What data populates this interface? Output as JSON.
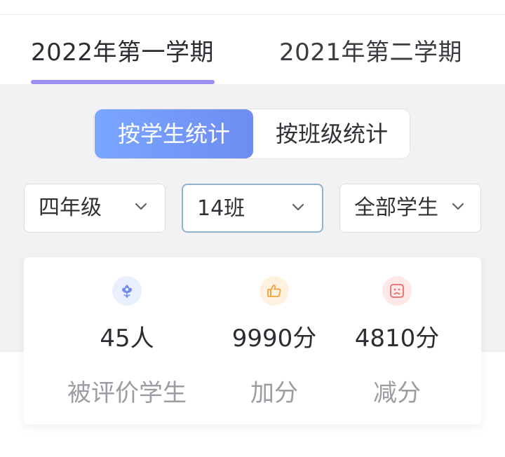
{
  "tabs": [
    {
      "label": "2022年第一学期",
      "active": true
    },
    {
      "label": "2021年第二学期",
      "active": false
    }
  ],
  "segment": {
    "by_student": "按学生统计",
    "by_class": "按班级统计",
    "selected": "按学生统计"
  },
  "filters": {
    "grade": "四年级",
    "class": "14班",
    "students": "全部学生"
  },
  "stats": [
    {
      "icon": "flower-icon",
      "value": "45人",
      "label": "被评价学生"
    },
    {
      "icon": "thumbs-up-icon",
      "value": "9990分",
      "label": "加分"
    },
    {
      "icon": "sad-face-icon",
      "value": "4810分",
      "label": "减分"
    }
  ],
  "colors": {
    "accent": "#6e8cf2",
    "tab_underline": "#9a8ef0",
    "icon_blue": "#6f8df0",
    "icon_orange": "#f0a23c",
    "icon_red": "#e86a6a",
    "background_band": "#f2f2f4"
  }
}
